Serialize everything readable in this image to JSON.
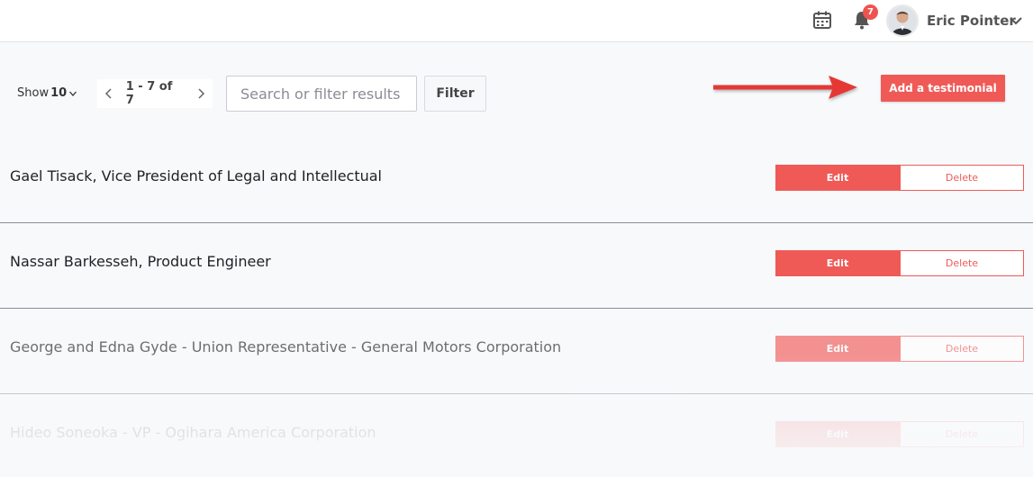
{
  "header": {
    "notification_count": "7",
    "user_name": "Eric Pointer",
    "icons": [
      "calendar-icon",
      "bell-icon",
      "avatar",
      "chevron-down-icon"
    ]
  },
  "toolbar": {
    "show_label": "Show",
    "show_value": "10",
    "pagination_text": "1 - 7 of 7",
    "search_placeholder": "Search or filter results",
    "filter_label": "Filter",
    "add_label": "Add a testimonial"
  },
  "testimonials": [
    {
      "name": "Gael Tisack, Vice President of Legal and Intellectual",
      "edit_label": "Edit",
      "delete_label": "Delete"
    },
    {
      "name": "Nassar Barkesseh, Product Engineer",
      "edit_label": "Edit",
      "delete_label": "Delete"
    },
    {
      "name": "George and Edna Gyde - Union Representative - General Motors Corporation",
      "edit_label": "Edit",
      "delete_label": "Delete"
    },
    {
      "name": "Hideo Soneoka - VP - Ogihara America Corporation",
      "edit_label": "Edit",
      "delete_label": "Delete"
    }
  ],
  "colors": {
    "accent": "#ef5a57",
    "badge": "#ef5350",
    "arrow": "#e53935"
  }
}
